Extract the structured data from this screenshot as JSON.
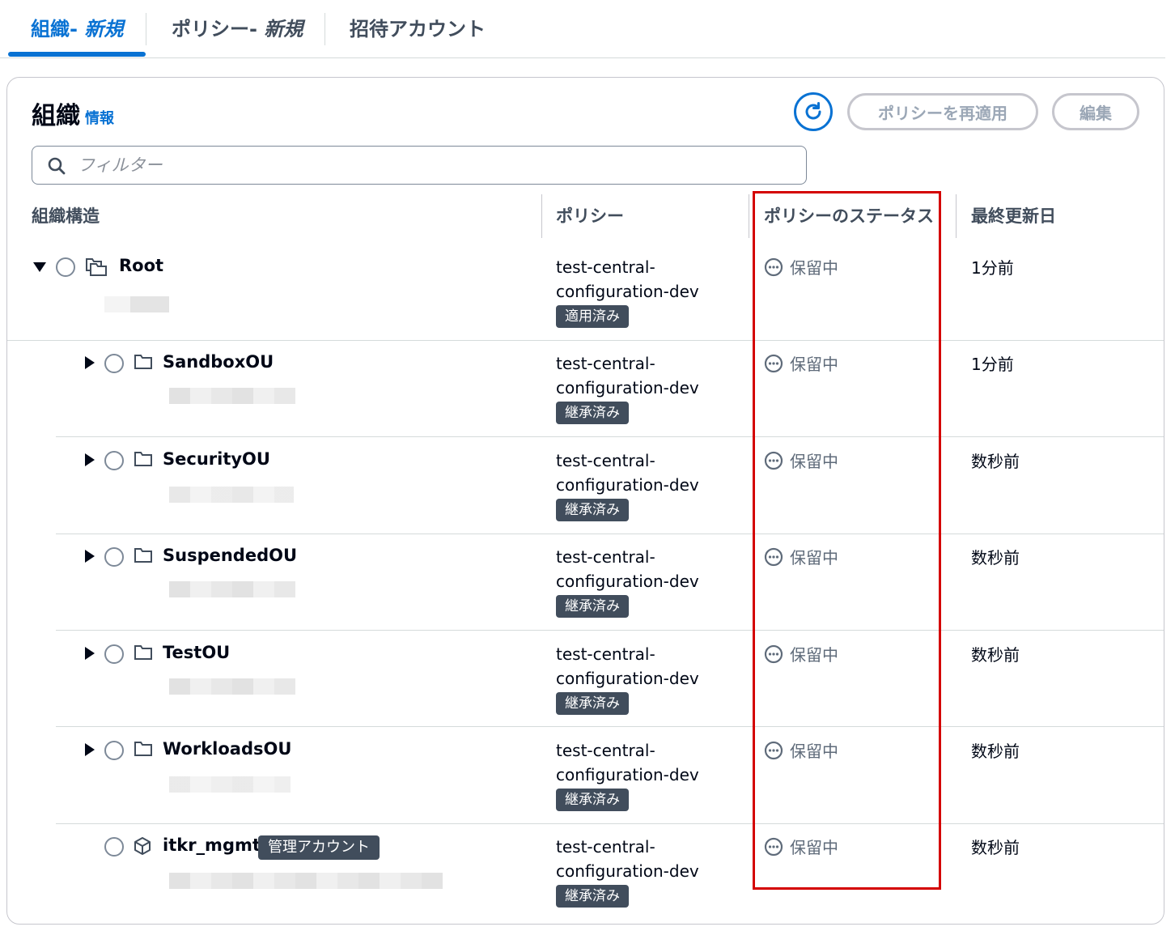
{
  "tabs": [
    {
      "label": "組織- ",
      "em": "新規"
    },
    {
      "label": "ポリシー- ",
      "em": "新規"
    },
    {
      "label": "招待アカウント",
      "em": ""
    }
  ],
  "panel": {
    "title": "組織",
    "info_link": "情報",
    "reapply_button": "ポリシーを再適用",
    "edit_button": "編集",
    "filter_placeholder": "フィルター"
  },
  "columns": {
    "structure": "組織構造",
    "policy": "ポリシー",
    "status": "ポリシーのステータス",
    "updated": "最終更新日"
  },
  "rows": [
    {
      "name": "Root",
      "policy_line1": "test-central-",
      "policy_line2": "configuration-dev",
      "tag": "適用済み",
      "status": "保留中",
      "updated": "1分前"
    },
    {
      "name": "SandboxOU",
      "policy_line1": "test-central-",
      "policy_line2": "configuration-dev",
      "tag": "継承済み",
      "status": "保留中",
      "updated": "1分前"
    },
    {
      "name": "SecurityOU",
      "policy_line1": "test-central-",
      "policy_line2": "configuration-dev",
      "tag": "継承済み",
      "status": "保留中",
      "updated": "数秒前"
    },
    {
      "name": "SuspendedOU",
      "policy_line1": "test-central-",
      "policy_line2": "configuration-dev",
      "tag": "継承済み",
      "status": "保留中",
      "updated": "数秒前"
    },
    {
      "name": "TestOU",
      "policy_line1": "test-central-",
      "policy_line2": "configuration-dev",
      "tag": "継承済み",
      "status": "保留中",
      "updated": "数秒前"
    },
    {
      "name": "WorkloadsOU",
      "policy_line1": "test-central-",
      "policy_line2": "configuration-dev",
      "tag": "継承済み",
      "status": "保留中",
      "updated": "数秒前"
    },
    {
      "name": "itkr_mgmt",
      "badge": "管理アカウント",
      "policy_line1": "test-central-",
      "policy_line2": "configuration-dev",
      "tag": "継承済み",
      "status": "保留中",
      "updated": "数秒前"
    }
  ],
  "colors": {
    "accent": "#0972d3",
    "highlight": "#d40000",
    "tag_bg": "#414d5c"
  }
}
